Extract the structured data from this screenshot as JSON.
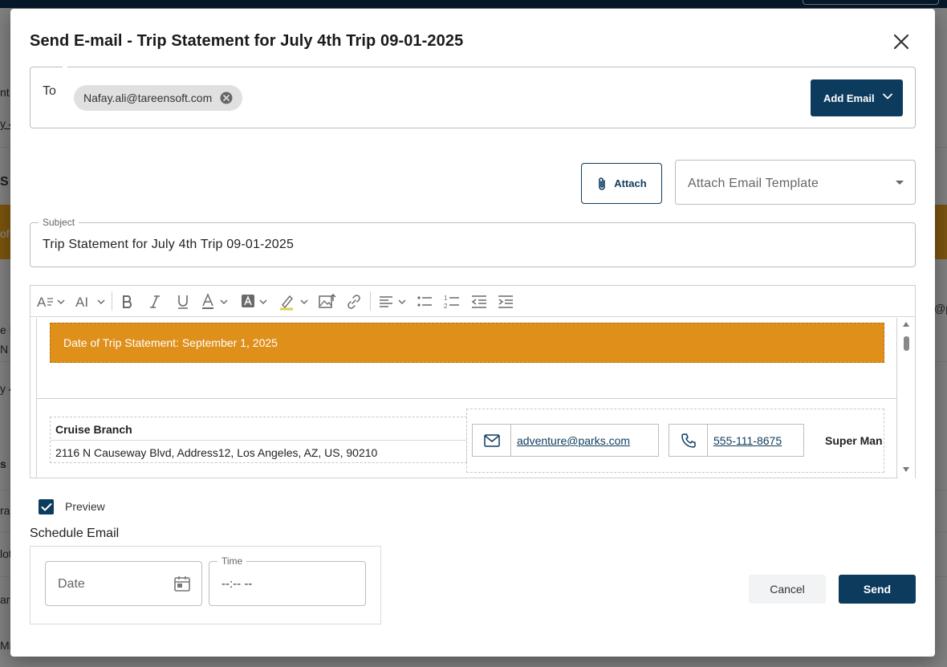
{
  "background": {
    "fragments": [
      "nt",
      "y 4",
      "S",
      "of",
      "e E",
      "N",
      "y 4",
      "s",
      "ra",
      "lot",
      "ar",
      "Mis",
      "@p"
    ]
  },
  "modal": {
    "title": "Send E-mail - Trip Statement for July 4th Trip 09-01-2025",
    "close_icon": "close-icon"
  },
  "to": {
    "label": "To",
    "recipients": [
      "Nafay.ali@tareensoft.com"
    ],
    "add_email_label": "Add Email"
  },
  "attach": {
    "label": "Attach",
    "template_placeholder": "Attach Email Template"
  },
  "subject": {
    "label": "Subject",
    "value": "Trip Statement for July 4th Trip 09-01-2025"
  },
  "editor": {
    "toolbar": [
      "font-family-icon",
      "font-size-icon",
      "bold-icon",
      "italic-icon",
      "underline-icon",
      "font-color-icon",
      "background-color-icon",
      "highlight-icon",
      "insert-image-icon",
      "insert-link-icon",
      "align-icon",
      "bulleted-list-icon",
      "numbered-list-icon",
      "outdent-icon",
      "indent-icon"
    ],
    "content": {
      "date_banner": "Date of Trip Statement: September 1, 2025",
      "branch_name": "Cruise Branch",
      "branch_address": "2116 N Causeway Blvd, Address12, Los Angeles, AZ, US, 90210",
      "email": "adventure@parks.com",
      "phone": "555-111-8675",
      "contact_name": "Super Man"
    }
  },
  "preview": {
    "label": "Preview",
    "checked": true
  },
  "schedule": {
    "label": "Schedule Email",
    "date_placeholder": "Date",
    "time_label": "Time",
    "time_value": "--:-- --"
  },
  "actions": {
    "cancel_label": "Cancel",
    "send_label": "Send"
  },
  "colors": {
    "primary": "#0d3b5e",
    "banner": "#df901b"
  }
}
